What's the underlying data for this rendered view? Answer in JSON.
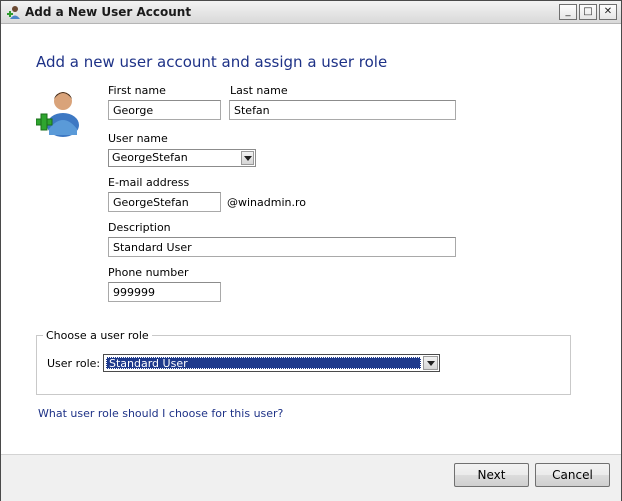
{
  "window": {
    "title": "Add a New User Account",
    "controls": {
      "minimize": "_",
      "maximize": "□",
      "close": "✕"
    }
  },
  "heading": "Add a new user account and assign a user role",
  "form": {
    "first_name": {
      "label": "First name",
      "value": "George"
    },
    "last_name": {
      "label": "Last name",
      "value": "Stefan"
    },
    "user_name": {
      "label": "User name",
      "value": "GeorgeStefan"
    },
    "email": {
      "label": "E-mail address",
      "value": "GeorgeStefan",
      "domain": "@winadmin.ro"
    },
    "description": {
      "label": "Description",
      "value": "Standard User"
    },
    "phone": {
      "label": "Phone number",
      "value": "999999"
    }
  },
  "role_group": {
    "title": "Choose a user role",
    "role_label": "User role:",
    "role_value": "Standard User"
  },
  "help_link": "What user role should I choose for this user?",
  "buttons": {
    "next": "Next",
    "cancel": "Cancel"
  },
  "icons": {
    "title": "add-user-icon",
    "avatar": "user-add-avatar-icon"
  },
  "colors": {
    "heading": "#1e3287",
    "selection": "#1f3a8c",
    "footer": "#f0f0f0"
  }
}
